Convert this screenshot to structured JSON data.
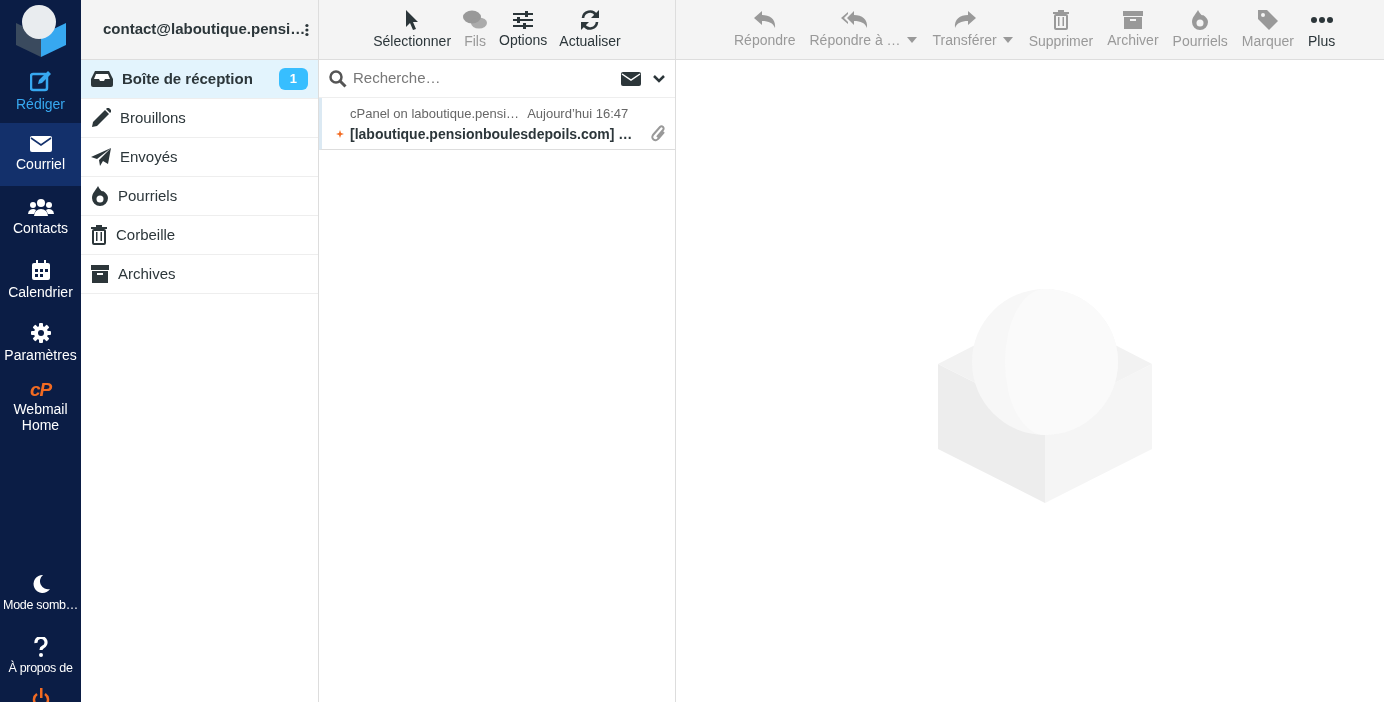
{
  "nav": {
    "items": [
      {
        "label": "Rédiger",
        "kind": "action",
        "selected": false
      },
      {
        "label": "Courriel",
        "kind": "section",
        "selected": true
      },
      {
        "label": "Contacts",
        "kind": "section",
        "selected": false
      },
      {
        "label": "Calendrier",
        "kind": "section",
        "selected": false
      },
      {
        "label": "Paramètres",
        "kind": "section",
        "selected": false
      },
      {
        "label": "Webmail Home",
        "kind": "link",
        "logo_text": "cP",
        "selected": false
      }
    ],
    "bottom_items": [
      {
        "label": "Mode somb…"
      },
      {
        "label": "À propos de"
      }
    ]
  },
  "account": {
    "title": "contact@laboutique.pensi…"
  },
  "folders": [
    {
      "label": "Boîte de réception",
      "selected": true,
      "unread": "1"
    },
    {
      "label": "Brouillons",
      "selected": false
    },
    {
      "label": "Envoyés",
      "selected": false
    },
    {
      "label": "Pourriels",
      "selected": false
    },
    {
      "label": "Corbeille",
      "selected": false
    },
    {
      "label": "Archives",
      "selected": false
    }
  ],
  "list_toolbar": [
    {
      "label": "Sélectionner",
      "disabled": false
    },
    {
      "label": "Fils",
      "disabled": true
    },
    {
      "label": "Options",
      "disabled": false
    },
    {
      "label": "Actualiser",
      "disabled": false
    }
  ],
  "search": {
    "placeholder": "Recherche…"
  },
  "messages": [
    {
      "from": "cPanel on laboutique.pensi…",
      "date": "Aujourd’hui 16:47",
      "subject": "[laboutique.pensionboulesdepoils.com] …",
      "unread": true,
      "attachment": true
    }
  ],
  "message_toolbar": [
    {
      "label": "Répondre",
      "disabled": true,
      "dropdown": false
    },
    {
      "label": "Répondre à …",
      "disabled": true,
      "dropdown": true
    },
    {
      "label": "Transférer",
      "disabled": true,
      "dropdown": true
    },
    {
      "label": "Supprimer",
      "disabled": true,
      "dropdown": false
    },
    {
      "label": "Archiver",
      "disabled": true,
      "dropdown": false
    },
    {
      "label": "Pourriels",
      "disabled": true,
      "dropdown": false
    },
    {
      "label": "Marquer",
      "disabled": true,
      "dropdown": false
    },
    {
      "label": "Plus",
      "disabled": false,
      "dropdown": false
    }
  ]
}
